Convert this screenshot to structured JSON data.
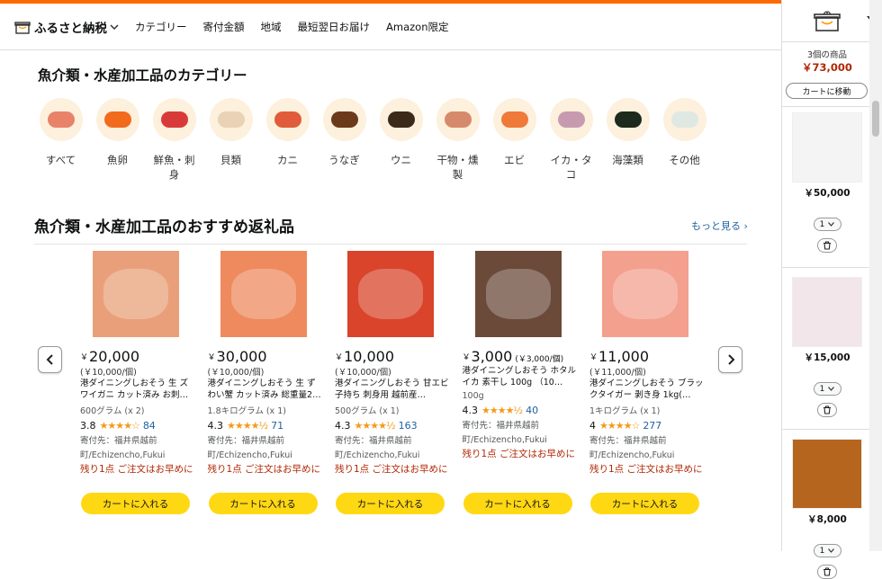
{
  "nav": {
    "brand": "ふるさと納税",
    "items": [
      "カテゴリー",
      "寄付金額",
      "地域",
      "最短翌日お届け",
      "Amazon限定"
    ]
  },
  "categories": {
    "title": "魚介類・水産加工品のカテゴリー",
    "items": [
      {
        "label": "すべて",
        "color": "#e8836a"
      },
      {
        "label": "魚卵",
        "color": "#f26b1d"
      },
      {
        "label": "鮮魚・刺身",
        "color": "#d83a3a"
      },
      {
        "label": "貝類",
        "color": "#e9d2b6"
      },
      {
        "label": "カニ",
        "color": "#e05c3a"
      },
      {
        "label": "うなぎ",
        "color": "#6b3a1a"
      },
      {
        "label": "ウニ",
        "color": "#3b2a1a"
      },
      {
        "label": "干物・燻製",
        "color": "#d68a6b"
      },
      {
        "label": "エビ",
        "color": "#f07a3a"
      },
      {
        "label": "イカ・タコ",
        "color": "#c89ab0"
      },
      {
        "label": "海藻類",
        "color": "#1d2a1d"
      },
      {
        "label": "その他",
        "color": "#dfe8e2"
      }
    ]
  },
  "recommend": {
    "title": "魚介類・水産加工品のおすすめ返礼品",
    "more": "もっと見る ›",
    "cart_label": "カートに入れる",
    "products": [
      {
        "price": "20,000",
        "unit_price": "",
        "per": "(￥10,000/個)",
        "name": "港ダイニングしおそう 生 ズワイガニ カット済み お刺…",
        "qty": "600グラム (x 2)",
        "rating": "3.8",
        "stars": "★★★★☆",
        "reviews": "84",
        "origin": "寄付先：福井県越前町/Echizencho,Fukui",
        "stock": "残り1点 ご注文はお早めに",
        "img": "#e9a07a"
      },
      {
        "price": "30,000",
        "unit_price": "",
        "per": "(￥10,000/個)",
        "name": "港ダイニングしおそう 生 ずわい蟹 カット済み 総重量2…",
        "qty": "1.8キログラム (x 1)",
        "rating": "4.3",
        "stars": "★★★★½",
        "reviews": "71",
        "origin": "寄付先：福井県越前町/Echizencho,Fukui",
        "stock": "残り1点 ご注文はお早めに",
        "img": "#ee8a5e"
      },
      {
        "price": "10,000",
        "unit_price": "",
        "per": "(￥10,000/個)",
        "name": "港ダイニングしおそう 甘エビ 子持ち 刺身用 越前産…",
        "qty": "500グラム (x 1)",
        "rating": "4.3",
        "stars": "★★★★½",
        "reviews": "163",
        "origin": "寄付先：福井県越前町/Echizencho,Fukui",
        "stock": "残り1点 ご注文はお早めに",
        "img": "#d9442a"
      },
      {
        "price": "3,000",
        "unit_price": "(￥3,000/個)",
        "per": "",
        "name": "港ダイニングしおそう ホタルイカ 素干し 100g （10…",
        "qty": "100g",
        "rating": "4.3",
        "stars": "★★★★½",
        "reviews": "40",
        "origin": "寄付先：福井県越前町/Echizencho,Fukui",
        "stock": "残り1点 ご注文はお早めに",
        "img": "#6b4a3a"
      },
      {
        "price": "11,000",
        "unit_price": "",
        "per": "(￥11,000/個)",
        "name": "港ダイニングしおそう ブラックタイガー 剥き身 1kg(…",
        "qty": "1キログラム (x 1)",
        "rating": "4",
        "stars": "★★★★☆",
        "reviews": "277",
        "origin": "寄付先：福井県越前町/Echizencho,Fukui",
        "stock": "残り1点 ご注文はお早めに",
        "img": "#f3a08e"
      }
    ]
  },
  "cart": {
    "count": "3個の商品",
    "total": "￥73,000",
    "go_cart": "カートに移動",
    "items": [
      {
        "price": "￥50,000",
        "qty": "1",
        "img": "#f4f4f4"
      },
      {
        "price": "￥15,000",
        "qty": "1",
        "img": "#f2e6ea"
      },
      {
        "price": "￥8,000",
        "qty": "1",
        "img": "#b5651d"
      }
    ]
  },
  "colors": {
    "accent": "#ff6a00",
    "cart_button": "#ffd814",
    "price_red": "#b12704",
    "link": "#2162a1"
  }
}
